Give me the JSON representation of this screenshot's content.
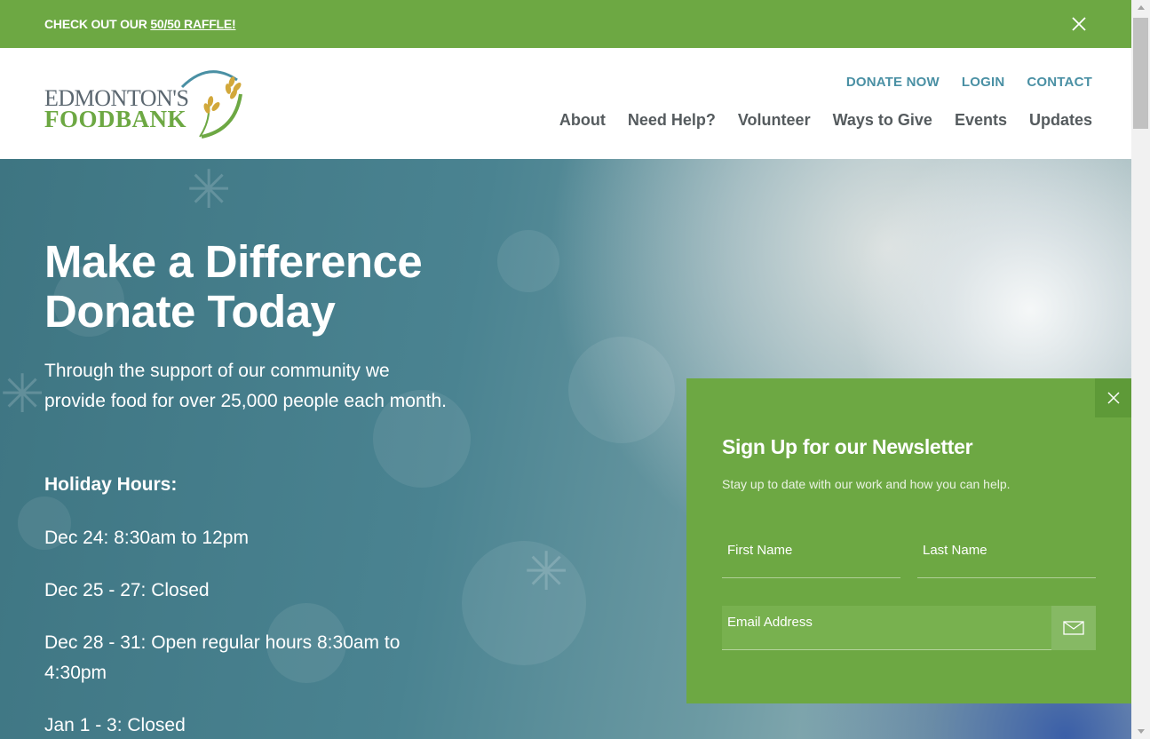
{
  "announcement": {
    "prefix": "CHECK OUT OUR ",
    "link": "50/50 RAFFLE!"
  },
  "logo": {
    "line1": "EDMONTON'S",
    "line2": "FOODBANK"
  },
  "utility_nav": [
    "DONATE NOW",
    "LOGIN",
    "CONTACT"
  ],
  "main_nav": [
    "About",
    "Need Help?",
    "Volunteer",
    "Ways to Give",
    "Events",
    "Updates"
  ],
  "hero": {
    "title_line1": "Make a Difference",
    "title_line2": "Donate Today",
    "lead": "Through the support of our community we provide food for over 25,000 people each month.",
    "holiday_heading": "Holiday Hours:",
    "hours": [
      "Dec 24: 8:30am to 12pm",
      "Dec 25 - 27: Closed",
      "Dec 28 - 31: Open regular hours 8:30am to 4:30pm",
      "Jan 1 - 3: Closed"
    ]
  },
  "newsletter": {
    "title": "Sign Up for our Newsletter",
    "subtitle": "Stay up to date with our work and how you can help.",
    "first_name_placeholder": "First Name",
    "last_name_placeholder": "Last Name",
    "email_placeholder": "Email Address"
  },
  "colors": {
    "brand_green": "#6da843",
    "link_blue": "#4a90a4",
    "nav_gray": "#555b5e"
  },
  "icons": {
    "announcement_close": "close-icon",
    "popup_close": "close-icon",
    "submit": "envelope-icon"
  }
}
